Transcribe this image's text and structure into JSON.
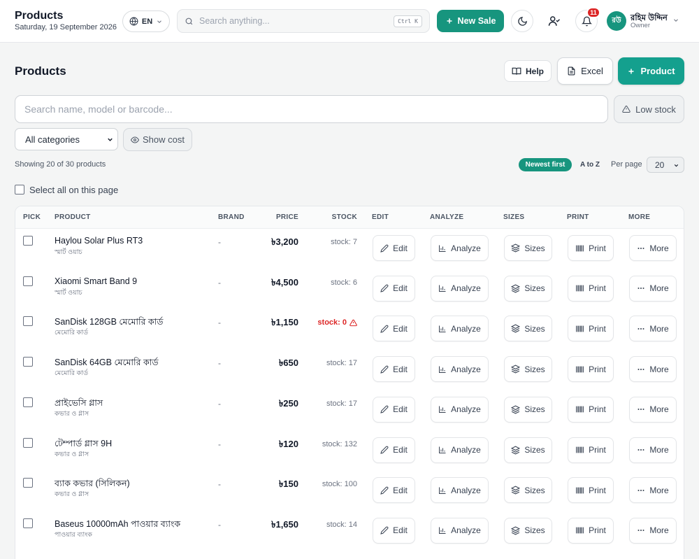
{
  "header": {
    "title": "Products",
    "date": "Saturday, 19 September 2026",
    "language": "EN",
    "search_placeholder": "Search anything...",
    "search_shortcut": "Ctrl K",
    "new_sale_label": "New Sale",
    "notification_count": "11",
    "user": {
      "initials": "রউ",
      "name": "রহিম উদ্দিন",
      "role": "Owner"
    }
  },
  "page": {
    "title": "Products",
    "help_label": "Help",
    "excel_label": "Excel",
    "add_product_label": "Product",
    "search_placeholder": "Search name, model or barcode...",
    "low_stock_label": "Low stock",
    "category_selected": "All categories",
    "show_cost_label": "Show cost",
    "showing_text": "Showing 20 of 30 products",
    "sort_newest": "Newest first",
    "sort_az": "A to Z",
    "per_page_label": "Per page",
    "per_page_value": "20",
    "select_all_label": "Select all on this page"
  },
  "table": {
    "headers": {
      "pick": "PICK",
      "product": "PRODUCT",
      "brand": "BRAND",
      "price": "PRICE",
      "stock": "STOCK",
      "edit": "EDIT",
      "analyze": "ANALYZE",
      "sizes": "SIZES",
      "print": "PRINT",
      "more": "MORE"
    },
    "action_labels": {
      "edit": "Edit",
      "analyze": "Analyze",
      "sizes": "Sizes",
      "print": "Print",
      "more": "More"
    },
    "rows": [
      {
        "name": "Haylou Solar Plus RT3",
        "category": "স্মার্ট ওয়াচ",
        "brand": "-",
        "price": "৳3,200",
        "stock": "stock: 7"
      },
      {
        "name": "Xiaomi Smart Band 9",
        "category": "স্মার্ট ওয়াচ",
        "brand": "-",
        "price": "৳4,500",
        "stock": "stock: 6"
      },
      {
        "name": "SanDisk 128GB মেমোরি কার্ড",
        "category": "মেমোরি কার্ড",
        "brand": "-",
        "price": "৳1,150",
        "stock": "stock: 0"
      },
      {
        "name": "SanDisk 64GB মেমোরি কার্ড",
        "category": "মেমোরি কার্ড",
        "brand": "-",
        "price": "৳650",
        "stock": "stock: 17"
      },
      {
        "name": "প্রাইভেসি গ্লাস",
        "category": "কভার ও গ্লাস",
        "brand": "-",
        "price": "৳250",
        "stock": "stock: 17"
      },
      {
        "name": "টেম্পার্ড গ্লাস 9H",
        "category": "কভার ও গ্লাস",
        "brand": "-",
        "price": "৳120",
        "stock": "stock: 132"
      },
      {
        "name": "ব্যাক কভার (সিলিকন)",
        "category": "কভার ও গ্লাস",
        "brand": "-",
        "price": "৳150",
        "stock": "stock: 100"
      },
      {
        "name": "Baseus 10000mAh পাওয়ার ব্যাংক",
        "category": "পাওয়ার ব্যাংক",
        "brand": "-",
        "price": "৳1,650",
        "stock": "stock: 14"
      }
    ]
  },
  "colors": {
    "accent": "#17957e",
    "danger": "#dc2626"
  }
}
